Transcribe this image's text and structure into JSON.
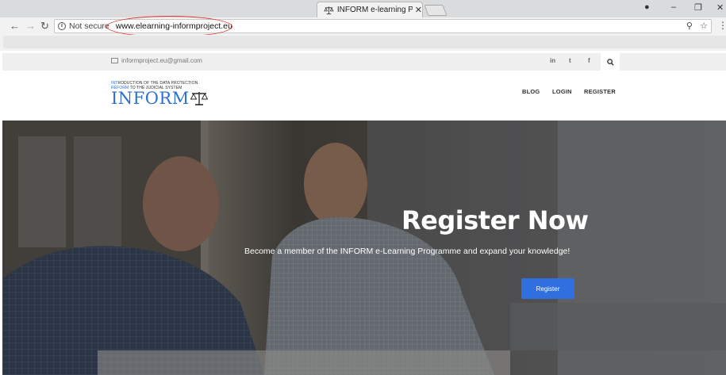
{
  "browser": {
    "tab_title": "INFORM e-learning Prog",
    "tab_close": "✕",
    "security_label": "Not secure",
    "url": "www.elearning-informproject.eu"
  },
  "topbar": {
    "email": "informproject.eu@gmail.com",
    "social": [
      "in",
      "t",
      "f"
    ]
  },
  "header": {
    "logo_line1_hl": "INT",
    "logo_line1": "RODUCTION OF THE DATA PROTECTION",
    "logo_line2_hl": "REFORM",
    "logo_line2": " TO THE JUDICIAL SYSTEM",
    "logo_word": "INFORM",
    "nav": [
      "BLOG",
      "LOGIN",
      "REGISTER"
    ]
  },
  "hero": {
    "title": "Register Now",
    "subtitle": "Become a member of the INFORM e-Learning Programme and expand your knowledge!",
    "button_label": "Register"
  },
  "colors": {
    "accent": "#2f6fe0",
    "logo_blue": "#2e6fcf",
    "url_highlight": "#e03030"
  }
}
